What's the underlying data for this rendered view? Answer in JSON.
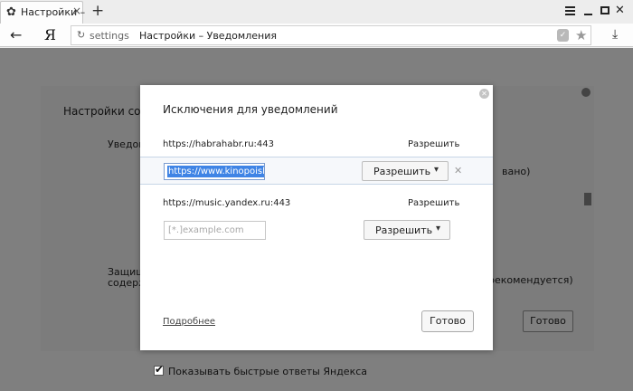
{
  "browser": {
    "tab_title": "Настройки –",
    "tab_close": "×",
    "new_tab": "+",
    "logo": "Я",
    "address_host": "settings",
    "address_title": "Настройки – Уведомления",
    "icons": [
      "gear-icon",
      "close-icon",
      "plus-icon",
      "menu-icon",
      "minimize-icon",
      "maximize-icon",
      "close-window-icon",
      "back-arrow-icon",
      "reload-icon",
      "shield-icon",
      "star-icon",
      "download-icon"
    ]
  },
  "background": {
    "settings_title": "Настройки соде",
    "notifications_label": "Уведом",
    "protect_label_1": "Защищ",
    "protect_label_2": "содерж",
    "right_text_1": "вано)",
    "right_text_2": "рекомендуется)",
    "done_label": "Готово",
    "quick_answers_label": "Показывать быстрые ответы Яндекса",
    "quick_answers_checked": true
  },
  "dialog": {
    "title": "Исключения для уведомлений",
    "rows": [
      {
        "site": "https://habrahabr.ru:443",
        "permission": "Разрешить"
      },
      {
        "site": "https://www.kinopoisk.ru",
        "site_visible": "https://www.kinopoisk.r",
        "permission": "Разрешить",
        "editing": true
      },
      {
        "site": "https://music.yandex.ru:443",
        "permission": "Разрешить"
      }
    ],
    "new_row": {
      "placeholder": "[*.]example.com",
      "permission": "Разрешить"
    },
    "more_link": "Подробнее",
    "done_label": "Готово"
  },
  "colors": {
    "selection": "#3f84e5",
    "overlay": "rgba(0,0,0,0.5)",
    "edit_row_bg": "#f6f8fb"
  }
}
